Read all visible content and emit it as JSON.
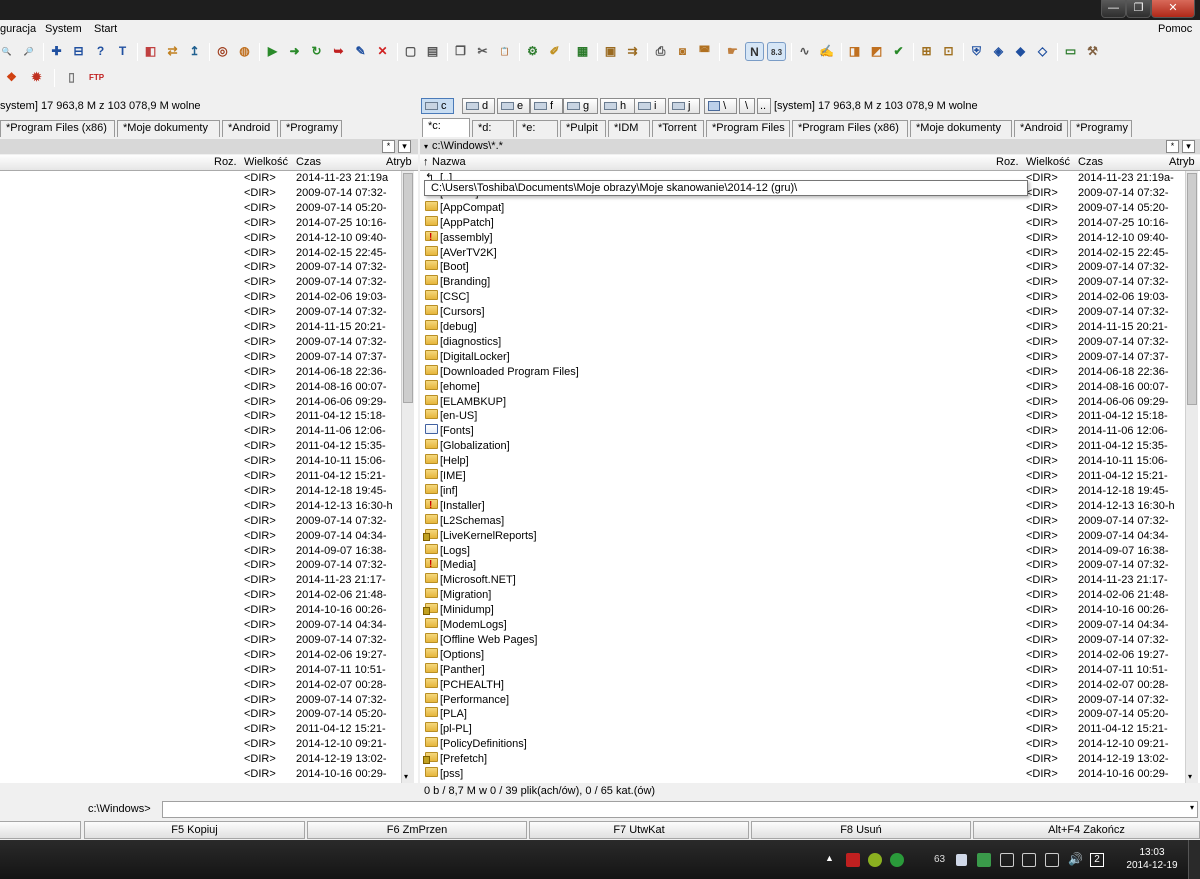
{
  "window": {
    "min": "—",
    "max": "❐",
    "close": "✕"
  },
  "menu": {
    "items": [
      "guracja",
      "System",
      "Start"
    ],
    "help": "Pomoc"
  },
  "toolbar": {
    "buttons": [
      {
        "name": "find-icon",
        "g": "🔍",
        "c": "#2a6fb8"
      },
      {
        "name": "find-file-icon",
        "g": "🔎",
        "c": "#2a6fb8"
      },
      {
        "name": "select-group-icon",
        "g": "✚",
        "c": "#2050a0"
      },
      {
        "name": "unselect-group-icon",
        "g": "⊟",
        "c": "#2050a0"
      },
      {
        "name": "select-all-icon",
        "g": "?",
        "c": "#2050a0"
      },
      {
        "name": "txt-view-icon",
        "g": "T",
        "c": "#2050a0"
      },
      {
        "name": "compare-icon",
        "g": "◧",
        "c": "#c04040"
      },
      {
        "name": "sync-icon",
        "g": "⇄",
        "c": "#c08020"
      },
      {
        "name": "copy-names-icon",
        "g": "↥",
        "c": "#206090"
      },
      {
        "name": "archive-icon",
        "g": "◎",
        "c": "#a04020"
      },
      {
        "name": "unpack-icon",
        "g": "◍",
        "c": "#c07020"
      },
      {
        "name": "run-icon",
        "g": "▶",
        "c": "#2a8a2a"
      },
      {
        "name": "go-forward-icon",
        "g": "➜",
        "c": "#2a8a2a"
      },
      {
        "name": "refresh-icon",
        "g": "↻",
        "c": "#2a8a2a"
      },
      {
        "name": "back-icon",
        "g": "➥",
        "c": "#c02020"
      },
      {
        "name": "edit-icon",
        "g": "✎",
        "c": "#2050a0"
      },
      {
        "name": "delete-icon",
        "g": "✕",
        "c": "#d02020"
      },
      {
        "name": "new-file-icon",
        "g": "▢",
        "c": "#555"
      },
      {
        "name": "properties-icon",
        "g": "▤",
        "c": "#555"
      },
      {
        "name": "copy-icon",
        "g": "❐",
        "c": "#555"
      },
      {
        "name": "cut-icon",
        "g": "✂",
        "c": "#555"
      },
      {
        "name": "paste-icon",
        "g": "📋",
        "c": "#555"
      },
      {
        "name": "network-icon",
        "g": "⚙",
        "c": "#2a7a2a"
      },
      {
        "name": "pencil-icon",
        "g": "✐",
        "c": "#c09020"
      },
      {
        "name": "server-icon",
        "g": "▦",
        "c": "#2a7a2a"
      },
      {
        "name": "package-icon",
        "g": "▣",
        "c": "#9a6a20"
      },
      {
        "name": "move-icon",
        "g": "⇉",
        "c": "#9a6a20"
      },
      {
        "name": "print-icon",
        "g": "⎙",
        "c": "#555"
      },
      {
        "name": "disk-icon",
        "g": "◙",
        "c": "#b07020"
      },
      {
        "name": "disk2-icon",
        "g": "◚",
        "c": "#b07020"
      },
      {
        "name": "hand-icon",
        "g": "☛",
        "c": "#c08040"
      },
      {
        "name": "brief-view-icon",
        "g": "N",
        "c": "#333",
        "toggle": true
      },
      {
        "name": "short-names-icon",
        "g": "8.3",
        "c": "#333",
        "toggle": true
      },
      {
        "name": "link-icon",
        "g": "∿",
        "c": "#555"
      },
      {
        "name": "rename-icon",
        "g": "✍",
        "c": "#2050a0"
      },
      {
        "name": "pack-icon",
        "g": "◨",
        "c": "#c07020"
      },
      {
        "name": "unpack-zip-icon",
        "g": "◩",
        "c": "#c07020"
      },
      {
        "name": "test-zip-icon",
        "g": "✔",
        "c": "#2a8a2a"
      },
      {
        "name": "tree-icon",
        "g": "⊞",
        "c": "#a07020"
      },
      {
        "name": "tree2-icon",
        "g": "⊡",
        "c": "#a07020"
      },
      {
        "name": "shield-icon",
        "g": "⛨",
        "c": "#2050a0"
      },
      {
        "name": "shield2-icon",
        "g": "◈",
        "c": "#2050a0"
      },
      {
        "name": "shield3-icon",
        "g": "◆",
        "c": "#2050a0"
      },
      {
        "name": "shield4-icon",
        "g": "◇",
        "c": "#2050a0"
      },
      {
        "name": "console-icon",
        "g": "▭",
        "c": "#2a7a2a"
      },
      {
        "name": "tools-icon",
        "g": "⚒",
        "c": "#806040"
      }
    ],
    "row2": [
      {
        "name": "windows-icon",
        "g": "❖",
        "c": "#d04010"
      },
      {
        "name": "settings-icon",
        "g": "✹",
        "c": "#c03020"
      },
      {
        "name": "document-icon",
        "g": "▯",
        "c": "#777"
      },
      {
        "name": "ftp-icon",
        "g": "FTP",
        "c": "#c02020"
      }
    ]
  },
  "left": {
    "free": "system]  17 963,8 M z 103 078,9 M wolne",
    "tabs": [
      "*Program Files (x86)",
      "*Moje dokumenty",
      "*Android",
      "*Programy"
    ],
    "columns": {
      "ext": "Roz.",
      "size": "Wielkość",
      "date": "Czas",
      "attr": "Atryb"
    },
    "rows": [
      [
        "<DIR>",
        "2014-11-23 21:19a"
      ],
      [
        "<DIR>",
        "2009-07-14 07:32-"
      ],
      [
        "<DIR>",
        "2009-07-14 05:20-"
      ],
      [
        "<DIR>",
        "2014-07-25 10:16-"
      ],
      [
        "<DIR>",
        "2014-12-10 09:40-"
      ],
      [
        "<DIR>",
        "2014-02-15 22:45-"
      ],
      [
        "<DIR>",
        "2009-07-14 07:32-"
      ],
      [
        "<DIR>",
        "2009-07-14 07:32-"
      ],
      [
        "<DIR>",
        "2014-02-06 19:03-"
      ],
      [
        "<DIR>",
        "2009-07-14 07:32-"
      ],
      [
        "<DIR>",
        "2014-11-15 20:21-"
      ],
      [
        "<DIR>",
        "2009-07-14 07:32-"
      ],
      [
        "<DIR>",
        "2009-07-14 07:37-"
      ],
      [
        "<DIR>",
        "2014-06-18 22:36-"
      ],
      [
        "<DIR>",
        "2014-08-16 00:07-"
      ],
      [
        "<DIR>",
        "2014-06-06 09:29-"
      ],
      [
        "<DIR>",
        "2011-04-12 15:18-"
      ],
      [
        "<DIR>",
        "2014-11-06 12:06-"
      ],
      [
        "<DIR>",
        "2011-04-12 15:35-"
      ],
      [
        "<DIR>",
        "2014-10-11 15:06-"
      ],
      [
        "<DIR>",
        "2011-04-12 15:21-"
      ],
      [
        "<DIR>",
        "2014-12-18 19:45-"
      ],
      [
        "<DIR>",
        "2014-12-13 16:30-h"
      ],
      [
        "<DIR>",
        "2009-07-14 07:32-"
      ],
      [
        "<DIR>",
        "2009-07-14 04:34-"
      ],
      [
        "<DIR>",
        "2014-09-07 16:38-"
      ],
      [
        "<DIR>",
        "2009-07-14 07:32-"
      ],
      [
        "<DIR>",
        "2014-11-23 21:17-"
      ],
      [
        "<DIR>",
        "2014-02-06 21:48-"
      ],
      [
        "<DIR>",
        "2014-10-16 00:26-"
      ],
      [
        "<DIR>",
        "2009-07-14 04:34-"
      ],
      [
        "<DIR>",
        "2009-07-14 07:32-"
      ],
      [
        "<DIR>",
        "2014-02-06 19:27-"
      ],
      [
        "<DIR>",
        "2014-07-11 10:51-"
      ],
      [
        "<DIR>",
        "2014-02-07 00:28-"
      ],
      [
        "<DIR>",
        "2009-07-14 07:32-"
      ],
      [
        "<DIR>",
        "2009-07-14 05:20-"
      ],
      [
        "<DIR>",
        "2011-04-12 15:21-"
      ],
      [
        "<DIR>",
        "2014-12-10 09:21-"
      ],
      [
        "<DIR>",
        "2014-12-19 13:02-"
      ],
      [
        "<DIR>",
        "2014-10-16 00:29-"
      ]
    ],
    "cmd_path": "c:\\Windows>"
  },
  "right": {
    "drives": [
      {
        "l": "c",
        "active": true
      },
      {
        "l": "d"
      },
      {
        "l": "e"
      },
      {
        "l": "f"
      },
      {
        "l": "g"
      },
      {
        "l": "h"
      },
      {
        "l": "i"
      },
      {
        "l": "j"
      }
    ],
    "net": "\\",
    "up": "\\",
    "dots": "..",
    "free": "[system]  17 963,8 M z 103 078,9 M wolne",
    "tabs": [
      "*c:",
      "*d:",
      "*e:",
      "*Pulpit",
      "*IDM",
      "*Torrent",
      "*Program Files",
      "*Program Files (x86)",
      "*Moje dokumenty",
      "*Android",
      "*Programy"
    ],
    "path": "c:\\Windows\\*.*",
    "columns": {
      "name": "Nazwa",
      "ext": "Roz.",
      "size": "Wielkość",
      "date": "Czas",
      "attr": "Atryb"
    },
    "rows": [
      {
        "n": "[..]",
        "s": "<DIR>",
        "d": "2014-11-23 21:19a-",
        "i": "up"
      },
      {
        "n": "[addins]",
        "s": "<DIR>",
        "d": "2009-07-14 07:32-"
      },
      {
        "n": "[AppCompat]",
        "s": "<DIR>",
        "d": "2009-07-14 05:20-"
      },
      {
        "n": "[AppPatch]",
        "s": "<DIR>",
        "d": "2014-07-25 10:16-"
      },
      {
        "n": "[assembly]",
        "s": "<DIR>",
        "d": "2014-12-10 09:40-",
        "i": "warn"
      },
      {
        "n": "[AVerTV2K]",
        "s": "<DIR>",
        "d": "2014-02-15 22:45-"
      },
      {
        "n": "[Boot]",
        "s": "<DIR>",
        "d": "2009-07-14 07:32-"
      },
      {
        "n": "[Branding]",
        "s": "<DIR>",
        "d": "2009-07-14 07:32-"
      },
      {
        "n": "[CSC]",
        "s": "<DIR>",
        "d": "2014-02-06 19:03-"
      },
      {
        "n": "[Cursors]",
        "s": "<DIR>",
        "d": "2009-07-14 07:32-"
      },
      {
        "n": "[debug]",
        "s": "<DIR>",
        "d": "2014-11-15 20:21-"
      },
      {
        "n": "[diagnostics]",
        "s": "<DIR>",
        "d": "2009-07-14 07:32-"
      },
      {
        "n": "[DigitalLocker]",
        "s": "<DIR>",
        "d": "2009-07-14 07:37-"
      },
      {
        "n": "[Downloaded Program Files]",
        "s": "<DIR>",
        "d": "2014-06-18 22:36-"
      },
      {
        "n": "[ehome]",
        "s": "<DIR>",
        "d": "2014-08-16 00:07-"
      },
      {
        "n": "[ELAMBKUP]",
        "s": "<DIR>",
        "d": "2014-06-06 09:29-"
      },
      {
        "n": "[en-US]",
        "s": "<DIR>",
        "d": "2011-04-12 15:18-"
      },
      {
        "n": "[Fonts]",
        "s": "<DIR>",
        "d": "2014-11-06 12:06-",
        "i": "font"
      },
      {
        "n": "[Globalization]",
        "s": "<DIR>",
        "d": "2011-04-12 15:35-"
      },
      {
        "n": "[Help]",
        "s": "<DIR>",
        "d": "2014-10-11 15:06-"
      },
      {
        "n": "[IME]",
        "s": "<DIR>",
        "d": "2011-04-12 15:21-"
      },
      {
        "n": "[inf]",
        "s": "<DIR>",
        "d": "2014-12-18 19:45-"
      },
      {
        "n": "[Installer]",
        "s": "<DIR>",
        "d": "2014-12-13 16:30-h",
        "i": "warn"
      },
      {
        "n": "[L2Schemas]",
        "s": "<DIR>",
        "d": "2009-07-14 07:32-"
      },
      {
        "n": "[LiveKernelReports]",
        "s": "<DIR>",
        "d": "2009-07-14 04:34-",
        "i": "lock"
      },
      {
        "n": "[Logs]",
        "s": "<DIR>",
        "d": "2014-09-07 16:38-"
      },
      {
        "n": "[Media]",
        "s": "<DIR>",
        "d": "2009-07-14 07:32-",
        "i": "warn"
      },
      {
        "n": "[Microsoft.NET]",
        "s": "<DIR>",
        "d": "2014-11-23 21:17-"
      },
      {
        "n": "[Migration]",
        "s": "<DIR>",
        "d": "2014-02-06 21:48-"
      },
      {
        "n": "[Minidump]",
        "s": "<DIR>",
        "d": "2014-10-16 00:26-",
        "i": "lock"
      },
      {
        "n": "[ModemLogs]",
        "s": "<DIR>",
        "d": "2009-07-14 04:34-"
      },
      {
        "n": "[Offline Web Pages]",
        "s": "<DIR>",
        "d": "2009-07-14 07:32-"
      },
      {
        "n": "[Options]",
        "s": "<DIR>",
        "d": "2014-02-06 19:27-"
      },
      {
        "n": "[Panther]",
        "s": "<DIR>",
        "d": "2014-07-11 10:51-"
      },
      {
        "n": "[PCHEALTH]",
        "s": "<DIR>",
        "d": "2014-02-07 00:28-"
      },
      {
        "n": "[Performance]",
        "s": "<DIR>",
        "d": "2009-07-14 07:32-"
      },
      {
        "n": "[PLA]",
        "s": "<DIR>",
        "d": "2009-07-14 05:20-"
      },
      {
        "n": "[pl-PL]",
        "s": "<DIR>",
        "d": "2011-04-12 15:21-"
      },
      {
        "n": "[PolicyDefinitions]",
        "s": "<DIR>",
        "d": "2014-12-10 09:21-"
      },
      {
        "n": "[Prefetch]",
        "s": "<DIR>",
        "d": "2014-12-19 13:02-",
        "i": "lock"
      },
      {
        "n": "[pss]",
        "s": "<DIR>",
        "d": "2014-10-16 00:29-"
      }
    ],
    "status": "0 b / 8,7 M w 0 / 39 plik(ach/ów), 0 / 65 kat.(ów)"
  },
  "tooltip": "C:\\Users\\Toshiba\\Documents\\Moje obrazy\\Moje skanowanie\\2014-12 (gru)\\",
  "fkeys": [
    "F5 Kopiuj",
    "F6 ZmPrzen",
    "F7 UtwKat",
    "F8 Usuń",
    "Alt+F4 Zakończ"
  ],
  "taskbar": {
    "time": "13:03",
    "date": "2014-12-19",
    "count": "63",
    "badge": "2"
  },
  "colors": {
    "folder": "#e6b63c",
    "selection": "#c8ddf2"
  }
}
